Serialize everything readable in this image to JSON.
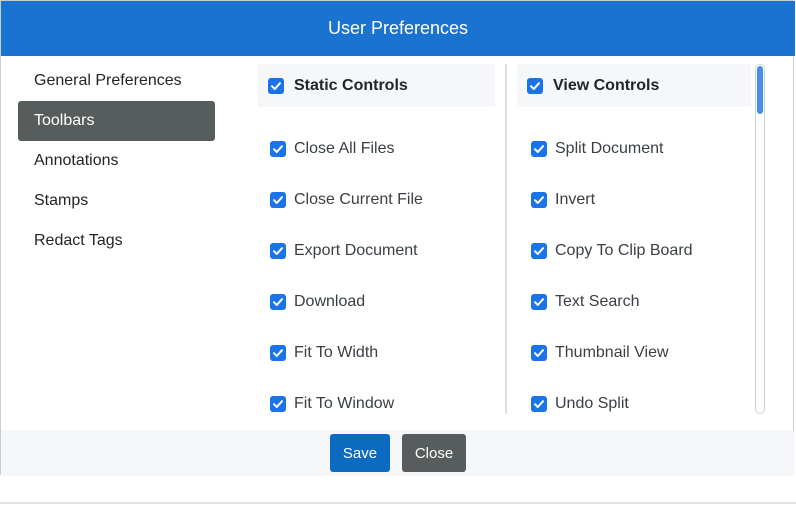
{
  "dialog": {
    "title": "User Preferences"
  },
  "sidebar": {
    "items": [
      {
        "label": "General Preferences",
        "active": false
      },
      {
        "label": "Toolbars",
        "active": true
      },
      {
        "label": "Annotations",
        "active": false
      },
      {
        "label": "Stamps",
        "active": false
      },
      {
        "label": "Redact Tags",
        "active": false
      }
    ]
  },
  "static_controls": {
    "header": "Static Controls",
    "header_checked": true,
    "options": [
      {
        "label": "Close All Files",
        "checked": true
      },
      {
        "label": "Close Current File",
        "checked": true
      },
      {
        "label": "Export Document",
        "checked": true
      },
      {
        "label": "Download",
        "checked": true
      },
      {
        "label": "Fit To Width",
        "checked": true
      },
      {
        "label": "Fit To Window",
        "checked": true
      }
    ]
  },
  "view_controls": {
    "header": "View Controls",
    "header_checked": true,
    "options": [
      {
        "label": "Split Document",
        "checked": true
      },
      {
        "label": "Invert",
        "checked": true
      },
      {
        "label": "Copy To Clip Board",
        "checked": true
      },
      {
        "label": "Text Search",
        "checked": true
      },
      {
        "label": "Thumbnail View",
        "checked": true
      },
      {
        "label": "Undo Split",
        "checked": true
      }
    ]
  },
  "footer": {
    "save_label": "Save",
    "close_label": "Close"
  },
  "colors": {
    "header_bg": "#1a73d1",
    "active_item_bg": "#575d5c",
    "checkbox": "#1a73e8",
    "save_button": "#0a6bc0",
    "close_button": "#575d5c"
  },
  "icons": {
    "checkbox": "check-icon"
  }
}
